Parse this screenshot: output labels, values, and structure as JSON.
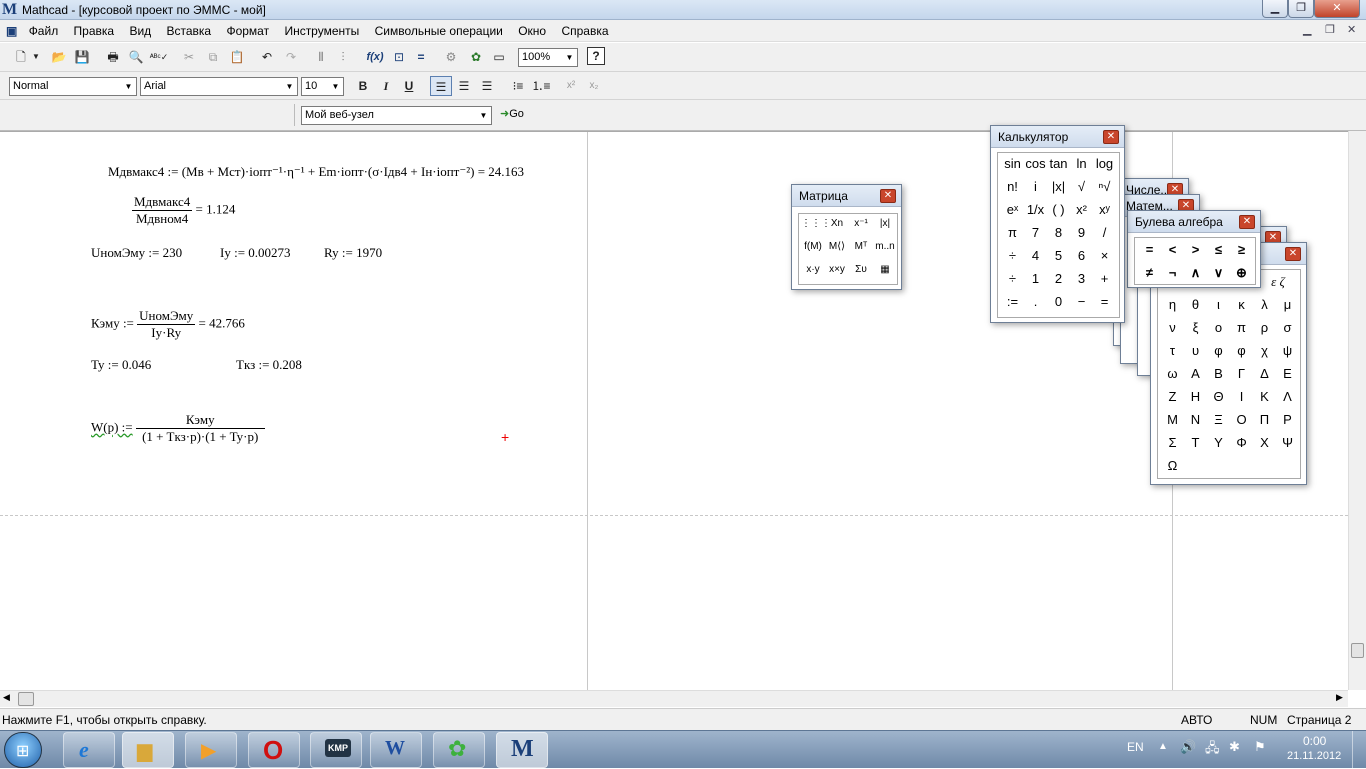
{
  "window": {
    "title": "Mathcad - [курсовой проект по ЭММС - мой]"
  },
  "menu": [
    "Файл",
    "Правка",
    "Вид",
    "Вставка",
    "Формат",
    "Инструменты",
    "Символьные операции",
    "Окно",
    "Справка"
  ],
  "toolbar": {
    "zoom": "100%",
    "help": "?"
  },
  "format": {
    "style": "Normal",
    "font": "Arial",
    "size": "10",
    "bold": "B",
    "italic": "I",
    "underline": "U",
    "super": "x²",
    "sub": "x₂"
  },
  "web": {
    "url": "Мой веб-узел",
    "go": "Go"
  },
  "math": {
    "eq1": "Мдвмакс4 := (Мв + Мст)·iопт⁻¹·η⁻¹ + Em·iопт·(σ·Iдв4 + Iн·iопт⁻²) = 24.163",
    "eq2_num": "Мдвмакс4",
    "eq2_den": "Мдвном4",
    "eq2_res": "= 1.124",
    "eq3a": "UномЭму := 230",
    "eq3b": "Iy := 0.00273",
    "eq3c": "Ry := 1970",
    "eq4_lhs": "Кэму :=",
    "eq4_num": "UномЭму",
    "eq4_den": "Iy·Ry",
    "eq4_res": "= 42.766",
    "eq5a": "Ty := 0.046",
    "eq5b": "Tкз := 0.208",
    "eq6_lhs": "W(p) :=",
    "eq6_num": "Кэму",
    "eq6_den": "(1 + Tкз·p)·(1 + Ty·p)"
  },
  "palettes": {
    "matrix": {
      "title": "Матрица",
      "items": [
        "⋮⋮⋮",
        "Xn",
        "x⁻¹",
        "|x|",
        "f(M)",
        "M⟨⟩",
        "Mᵀ",
        "m..n",
        "x·y",
        "x×y",
        "Συ",
        "▦"
      ]
    },
    "calc": {
      "title": "Калькулятор",
      "items": [
        "sin",
        "cos",
        "tan",
        "ln",
        "log",
        "n!",
        "i",
        "|x|",
        "√",
        "ⁿ√",
        "eˣ",
        "1/x",
        "( )",
        "x²",
        "xʸ",
        "π",
        "7",
        "8",
        "9",
        "/",
        "÷",
        "4",
        "5",
        "6",
        "×",
        "÷",
        "1",
        "2",
        "3",
        "+",
        ":=",
        ".",
        "0",
        "−",
        "="
      ]
    },
    "bool": {
      "title": "Булева алгебра",
      "items": [
        "=",
        "<",
        ">",
        "≤",
        "≥",
        "≠",
        "¬",
        "∧",
        "∨",
        "⊕"
      ]
    },
    "greek": {
      "items": [
        "η",
        "θ",
        "ι",
        "κ",
        "λ",
        "μ",
        "ν",
        "ξ",
        "ο",
        "π",
        "ρ",
        "σ",
        "τ",
        "υ",
        "φ",
        "φ",
        "χ",
        "ψ",
        "ω",
        "Α",
        "Β",
        "Γ",
        "Δ",
        "Ε",
        "Ζ",
        "Η",
        "Θ",
        "Ι",
        "Κ",
        "Λ",
        "Μ",
        "Ν",
        "Ξ",
        "Ο",
        "Π",
        "Ρ",
        "Σ",
        "Τ",
        "Υ",
        "Φ",
        "Χ",
        "Ψ",
        "Ω"
      ],
      "top_partial": "ε ζ"
    },
    "back1": "Числе...",
    "back2": "Матем..."
  },
  "status": {
    "help": "Нажмите F1, чтобы открыть справку.",
    "auto": "АВТО",
    "num": "NUM",
    "page": "Страница 2"
  },
  "tray": {
    "lang": "EN",
    "time": "0:00",
    "date": "21.11.2012"
  }
}
